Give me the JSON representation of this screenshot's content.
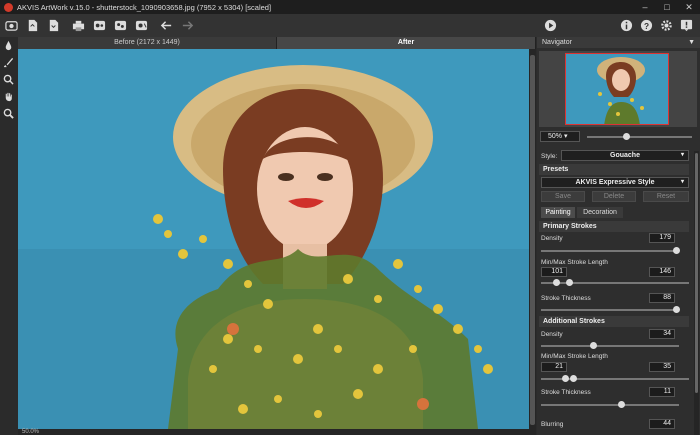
{
  "window": {
    "title": "AKVIS ArtWork v.15.0 - shutterstock_1090903658.jpg (7952 x 5304) [scaled]"
  },
  "tabs": {
    "before": "Before (2172 x 1449)",
    "after": "After"
  },
  "status": {
    "zoom": "50.0%"
  },
  "navigator": {
    "title": "Navigator",
    "zoom": "50%"
  },
  "settings": {
    "style_label": "Style:",
    "style_value": "Gouache",
    "presets_label": "Presets",
    "preset_value": "AKVIS Expressive Style",
    "save": "Save",
    "delete": "Delete",
    "reset": "Reset",
    "tab_painting": "Painting",
    "tab_decoration": "Decoration",
    "primary": {
      "title": "Primary Strokes",
      "density_label": "Density",
      "density": "179",
      "density_level": 0.98,
      "minmax_label": "Min/Max Stroke Length",
      "min": "101",
      "max": "146",
      "thickness_label": "Stroke Thickness",
      "thickness": "88",
      "thickness_level": 0.98
    },
    "additional": {
      "title": "Additional Strokes",
      "density_label": "Density",
      "density": "34",
      "density_level": 0.38,
      "minmax_label": "Min/Max Stroke Length",
      "min": "21",
      "max": "35",
      "thickness_label": "Stroke Thickness",
      "thickness": "11",
      "thickness_level": 0.58
    },
    "blurring_label": "Blurring",
    "blurring": "44"
  },
  "colors": {
    "accent": "#3e99bd",
    "background": "#2b2b2b",
    "logo": "#d23a2a"
  }
}
